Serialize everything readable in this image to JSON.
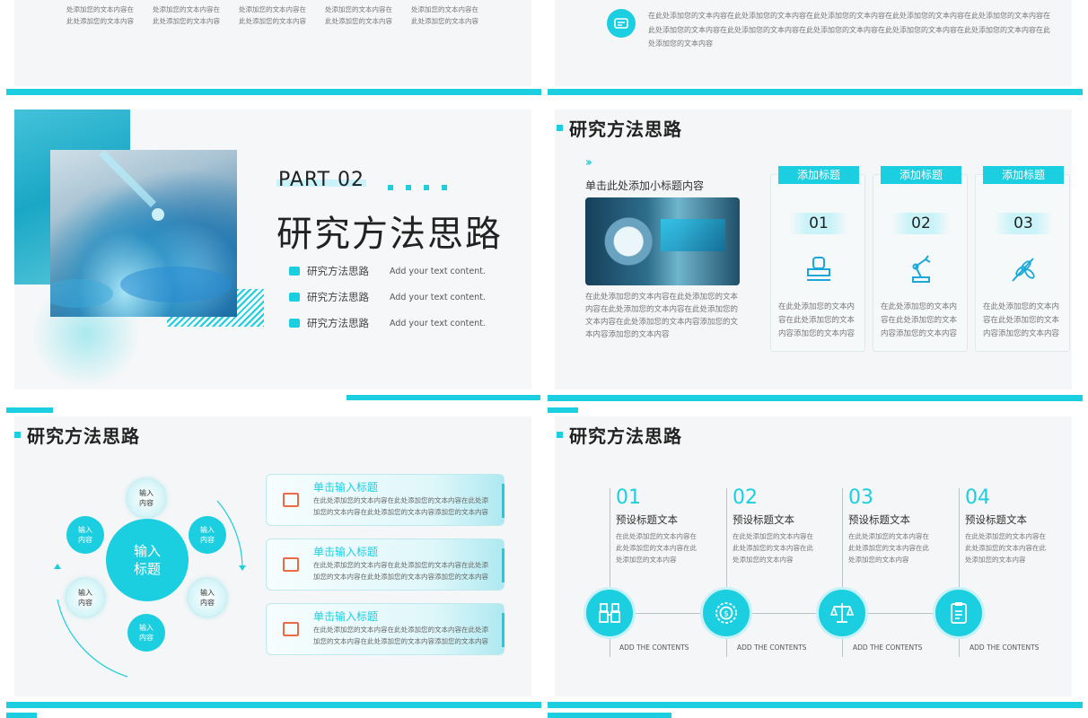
{
  "slide_a": {
    "cols": [
      [
        "处添加您的文本内容在",
        "此处添加您的文本内容"
      ],
      [
        "处添加您的文本内容在",
        "此处添加您的文本内容"
      ],
      [
        "处添加您的文本内容在",
        "此处添加您的文本内容"
      ],
      [
        "处添加您的文本内容在",
        "此处添加您的文本内容"
      ],
      [
        "处添加您的文本内容在",
        "此处添加您的文本内容"
      ]
    ]
  },
  "slide_b": {
    "text": "在此处添加您的文本内容在此处添加您的文本内容在此处添加您的文本内容在此处添加您的文本内容在此处添加您的文本内容在此处添加您的文本内容在此处添加您的文本内容在此处添加您的文本内容在此处添加您的文本内容在此处添加您的文本内容在此处添加您的文本内容"
  },
  "slide_c": {
    "part": "PART 02",
    "title": "研究方法思路",
    "rows": [
      {
        "label": "研究方法思路",
        "text": "Add your text content."
      },
      {
        "label": "研究方法思路",
        "text": "Add your text content."
      },
      {
        "label": "研究方法思路",
        "text": "Add your text content."
      }
    ]
  },
  "slide_d": {
    "title": "研究方法思路",
    "subtitle": "单击此处添加小标题内容",
    "text": "在此处添加您的文本内容在此处添加您的文本内容在此处添加您的文本内容在此处添加您的文本内容在此处添加您的文本内容添加您的文本内容添加您的文本内容",
    "cards": [
      {
        "tab": "添加标题",
        "num": "01",
        "icon": "stamp-icon",
        "text": "在此处添加您的文本内容在此处添加您的文本内容添加您的文本内容"
      },
      {
        "tab": "添加标题",
        "num": "02",
        "icon": "robot-arm-icon",
        "text": "在此处添加您的文本内容在此处添加您的文本内容添加您的文本内容"
      },
      {
        "tab": "添加标题",
        "num": "03",
        "icon": "wheat-icon",
        "text": "在此处添加您的文本内容在此处添加您的文本内容添加您的文本内容"
      }
    ]
  },
  "slide_e": {
    "title": "研究方法思路",
    "center": "输入\n标题",
    "nodes": [
      "输入\n内容",
      "输入\n内容",
      "输入\n内容",
      "输入\n内容",
      "输入\n内容",
      "输入\n内容"
    ],
    "boxes": [
      {
        "title": "单击输入标题",
        "text": "在此处添加您的文本内容在此处添加您的文本内容在此处添加您的文本内容在此处添加您的文本内容添加您的文本内容"
      },
      {
        "title": "单击输入标题",
        "text": "在此处添加您的文本内容在此处添加您的文本内容在此处添加您的文本内容在此处添加您的文本内容添加您的文本内容"
      },
      {
        "title": "单击输入标题",
        "text": "在此处添加您的文本内容在此处添加您的文本内容在此处添加您的文本内容在此处添加您的文本内容添加您的文本内容"
      }
    ]
  },
  "slide_f": {
    "title": "研究方法思路",
    "steps": [
      {
        "num": "01",
        "title": "预设标题文本",
        "text": "在此处添加您的文本内容在此处添加您的文本内容在此处添加您的文本内容",
        "icon": "binoculars-icon",
        "add": "ADD THE CONTENTS"
      },
      {
        "num": "02",
        "title": "预设标题文本",
        "text": "在此处添加您的文本内容在此处添加您的文本内容在此处添加您的文本内容",
        "icon": "coin-target-icon",
        "add": "ADD THE CONTENTS"
      },
      {
        "num": "03",
        "title": "预设标题文本",
        "text": "在此处添加您的文本内容在此处添加您的文本内容在此处添加您的文本内容",
        "icon": "scales-icon",
        "add": "ADD THE CONTENTS"
      },
      {
        "num": "04",
        "title": "预设标题文本",
        "text": "在此处添加您的文本内容在此处添加您的文本内容在此处添加您的文本内容",
        "icon": "clipboard-icon",
        "add": "ADD THE CONTENTS"
      }
    ]
  },
  "colors": {
    "accent": "#1ccfe0",
    "secondary_accent": "#ea6a45"
  }
}
